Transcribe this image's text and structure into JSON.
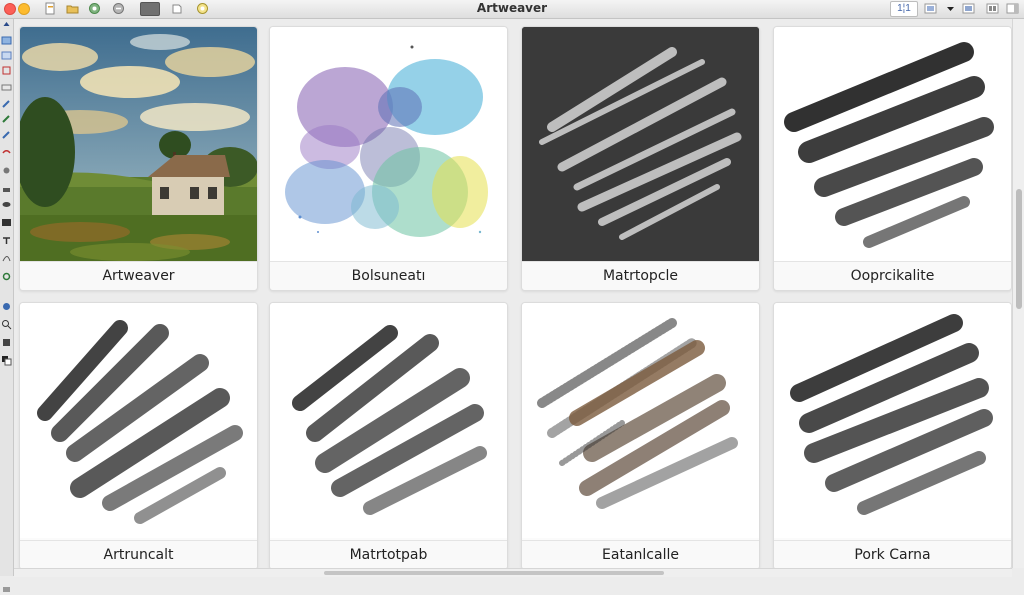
{
  "window": {
    "title": "Artweaver"
  },
  "toolbar_right": {
    "zoom_label": "1¦1"
  },
  "gallery": {
    "cards": [
      {
        "caption": "Artweaver",
        "icon": "oil-painting-landscape"
      },
      {
        "caption": "Bolsuneatı",
        "icon": "watercolor-blots"
      },
      {
        "caption": "Matrtopcle",
        "icon": "chalk-strokes"
      },
      {
        "caption": "Ooprcikalite",
        "icon": "charcoal-strokes"
      },
      {
        "caption": "Artruncalt",
        "icon": "ink-brush-strokes"
      },
      {
        "caption": "Matrtotpab",
        "icon": "ink-brush-strokes"
      },
      {
        "caption": "Eatanlcalle",
        "icon": "pastel-strokes"
      },
      {
        "caption": "Pork Carna",
        "icon": "charcoal-strokes"
      }
    ]
  },
  "colors": {
    "close": "#fc5f57",
    "minimize": "#fdbb2e",
    "chrome": "#ececec"
  }
}
